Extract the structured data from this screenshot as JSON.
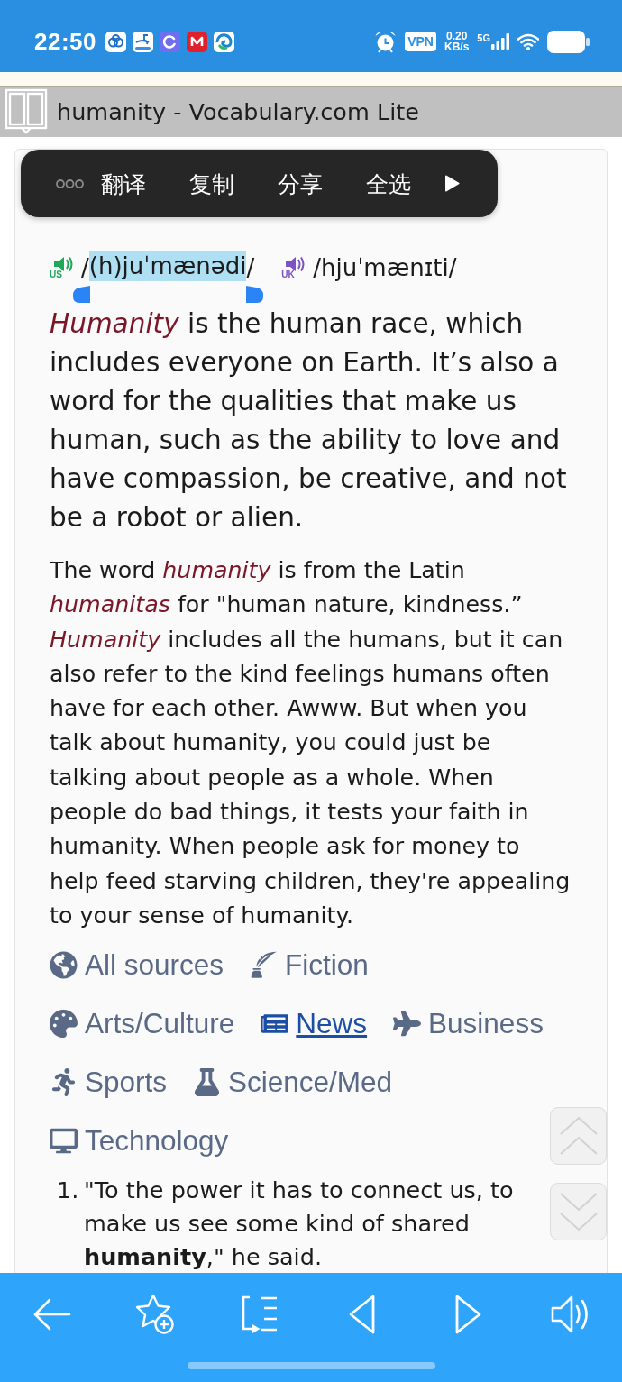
{
  "status_bar": {
    "time": "22:50",
    "vpn": "VPN",
    "speed_value": "0.20",
    "speed_unit": "KB/s",
    "network": "5G"
  },
  "title_bar": {
    "title": "humanity - Vocabulary.com Lite"
  },
  "selection_menu": {
    "items": [
      "翻译",
      "复制",
      "分享",
      "全选"
    ]
  },
  "pronunciations": [
    {
      "region": "US",
      "color": "#1ea85a",
      "parts": [
        {
          "text": "/",
          "selected": false
        },
        {
          "text": "(h)juˈmænədi",
          "selected": true
        },
        {
          "text": "/",
          "selected": false
        }
      ]
    },
    {
      "region": "UK",
      "color": "#7d52c4",
      "parts": [
        {
          "text": "/hjuˈmænɪti/",
          "selected": false
        }
      ]
    }
  ],
  "short_definition": "*Humanity* is the human race, which includes everyone on Earth. It’s also a word for the qualities that make us human, such as the ability to love and have compassion, be creative, and not be a robot or alien.",
  "long_definition": "The word *humanity* is from the Latin *humanitas* for \"human nature, kindness.” *Humanity* includes all the humans, but it can also refer to the kind feelings humans often have for each other. Awww. But when you talk about humanity, you could just be talking about people as a whole. When people do bad things, it tests your faith in humanity. When people ask for money to help feed starving children, they're appealing to your sense of humanity.",
  "sources": [
    {
      "label": "All sources",
      "selected": false
    },
    {
      "label": "Fiction",
      "selected": false
    },
    {
      "label": "Arts/Culture",
      "selected": false
    },
    {
      "label": "News",
      "selected": true
    },
    {
      "label": "Business",
      "selected": false
    },
    {
      "label": "Sports",
      "selected": false
    },
    {
      "label": "Science/Med",
      "selected": false
    },
    {
      "label": "Technology",
      "selected": false
    }
  ],
  "examples": [
    {
      "number": "1.",
      "text": "\"To the power it has to connect us, to make us see some kind of shared **humanity**,\" he said."
    }
  ]
}
